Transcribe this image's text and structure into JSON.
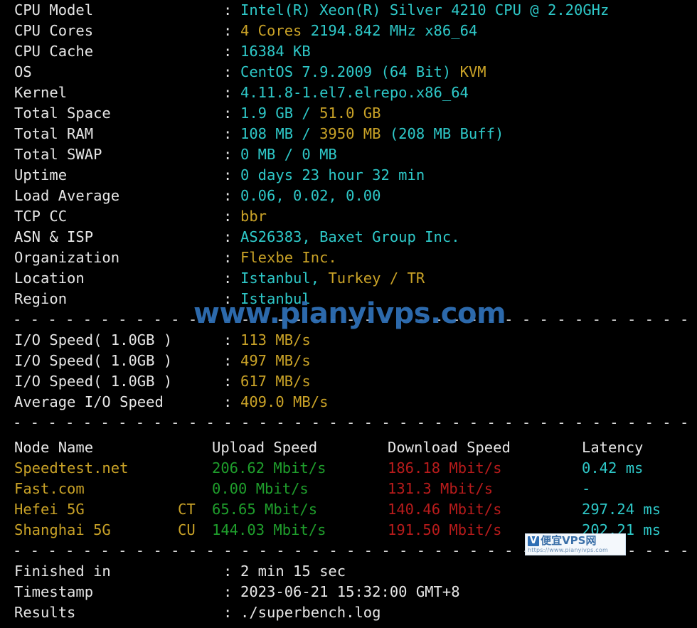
{
  "info_rows": [
    {
      "label": "CPU Model",
      "value_parts": [
        {
          "text": "Intel(R) Xeon(R) Silver 4210 CPU @ 2.20GHz",
          "color": "cyan"
        }
      ]
    },
    {
      "label": "CPU Cores",
      "value_parts": [
        {
          "text": "4 Cores",
          "color": "yellow"
        },
        {
          "text": " ",
          "color": "white"
        },
        {
          "text": "2194.842 MHz x86_64",
          "color": "cyan"
        }
      ]
    },
    {
      "label": "CPU Cache",
      "value_parts": [
        {
          "text": "16384 KB",
          "color": "cyan"
        }
      ]
    },
    {
      "label": "OS",
      "value_parts": [
        {
          "text": "CentOS 7.9.2009 (64 Bit)",
          "color": "cyan"
        },
        {
          "text": " ",
          "color": "white"
        },
        {
          "text": "KVM",
          "color": "yellow"
        }
      ]
    },
    {
      "label": "Kernel",
      "value_parts": [
        {
          "text": "4.11.8-1.el7.elrepo.x86_64",
          "color": "cyan"
        }
      ]
    },
    {
      "label": "Total Space",
      "value_parts": [
        {
          "text": "1.9 GB",
          "color": "cyan"
        },
        {
          "text": " / ",
          "color": "cyan"
        },
        {
          "text": "51.0 GB",
          "color": "yellow"
        }
      ]
    },
    {
      "label": "Total RAM",
      "value_parts": [
        {
          "text": "108 MB",
          "color": "cyan"
        },
        {
          "text": " / ",
          "color": "cyan"
        },
        {
          "text": "3950 MB",
          "color": "yellow"
        },
        {
          "text": " (208 MB Buff)",
          "color": "cyan"
        }
      ]
    },
    {
      "label": "Total SWAP",
      "value_parts": [
        {
          "text": "0 MB / 0 MB",
          "color": "cyan"
        }
      ]
    },
    {
      "label": "Uptime",
      "value_parts": [
        {
          "text": "0 days 23 hour 32 min",
          "color": "cyan"
        }
      ]
    },
    {
      "label": "Load Average",
      "value_parts": [
        {
          "text": "0.06, 0.02, 0.00",
          "color": "cyan"
        }
      ]
    },
    {
      "label": "TCP CC",
      "value_parts": [
        {
          "text": "bbr",
          "color": "yellow"
        }
      ]
    },
    {
      "label": "ASN & ISP",
      "value_parts": [
        {
          "text": "AS26383, Baxet Group Inc.",
          "color": "cyan"
        }
      ]
    },
    {
      "label": "Organization",
      "value_parts": [
        {
          "text": "Flexbe Inc.",
          "color": "yellow"
        }
      ]
    },
    {
      "label": "Location",
      "value_parts": [
        {
          "text": "Istanbul",
          "color": "cyan"
        },
        {
          "text": ", ",
          "color": "cyan"
        },
        {
          "text": "Turkey / TR",
          "color": "yellow"
        }
      ]
    },
    {
      "label": "Region",
      "value_parts": [
        {
          "text": "Istanbul",
          "color": "cyan"
        }
      ]
    }
  ],
  "io_rows": [
    {
      "label": "I/O Speed( 1.0GB )",
      "value": "113 MB/s",
      "color": "yellow"
    },
    {
      "label": "I/O Speed( 1.0GB )",
      "value": "497 MB/s",
      "color": "yellow"
    },
    {
      "label": "I/O Speed( 1.0GB )",
      "value": "617 MB/s",
      "color": "yellow"
    },
    {
      "label": "Average I/O Speed",
      "value": "409.0 MB/s",
      "color": "yellow"
    }
  ],
  "speedtest": {
    "headers": {
      "node": "Node Name",
      "cc": "",
      "upload": "Upload Speed",
      "download": "Download Speed",
      "latency": "Latency"
    },
    "rows": [
      {
        "node": "Speedtest.net",
        "cc": "",
        "upload": "206.62 Mbit/s",
        "download": "186.18 Mbit/s",
        "latency": "0.42 ms"
      },
      {
        "node": "Fast.com",
        "cc": "",
        "upload": "0.00 Mbit/s",
        "download": "131.3 Mbit/s",
        "latency": "-"
      },
      {
        "node": "Hefei 5G",
        "cc": "CT",
        "upload": "65.65 Mbit/s",
        "download": "140.46 Mbit/s",
        "latency": "297.24 ms"
      },
      {
        "node": "Shanghai 5G",
        "cc": "CU",
        "upload": "144.03 Mbit/s",
        "download": "191.50 Mbit/s",
        "latency": "202.21 ms"
      }
    ]
  },
  "footer_rows": [
    {
      "label": "Finished in",
      "value": "2 min 15 sec"
    },
    {
      "label": "Timestamp",
      "value": "2023-06-21 15:32:00 GMT+8"
    },
    {
      "label": "Results",
      "value": "./superbench.log"
    }
  ],
  "separator": "- - - - - - - - - - - - - - - - - - - - - - - - - - - - - - - - - - - - - - - - - - - - - - - - - - - - - - - - -",
  "watermark": {
    "main_text": "www.pianyivps.com",
    "badge_logo": "V",
    "badge_title": "便宜VPS网",
    "badge_url": "https://www.pianyivps.com"
  },
  "colors": {
    "background": "#000000",
    "white": "#e6e6e6",
    "cyan": "#2ec8c8",
    "yellow": "#c9a227",
    "green": "#1f9e2c",
    "red": "#b81b1b",
    "watermark_blue": "#2f6fb5"
  }
}
